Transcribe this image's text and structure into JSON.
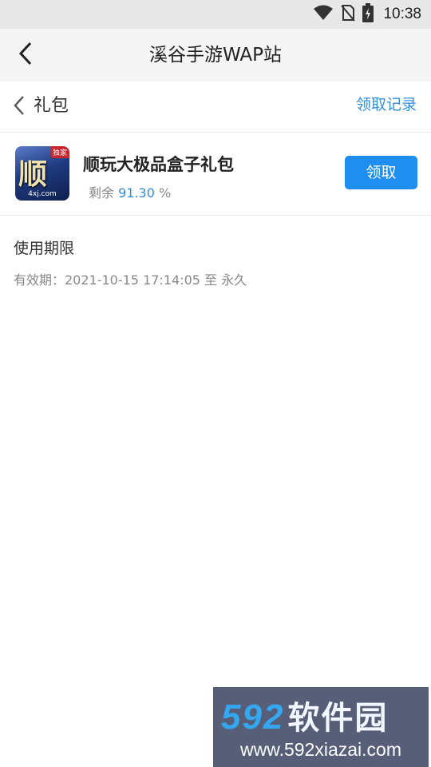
{
  "status_bar": {
    "time": "10:38",
    "icons": [
      "wifi-icon",
      "no-sim-icon",
      "battery-charging-icon"
    ]
  },
  "app_bar": {
    "title": "溪谷手游WAP站",
    "back_icon": "chevron-left-icon"
  },
  "sub_header": {
    "title": "礼包",
    "back_icon": "chevron-left-icon",
    "link": "领取记录"
  },
  "gift": {
    "name": "顺玩大极品盒子礼包",
    "remaining_label": "剩余",
    "remaining_value": "91.30",
    "remaining_unit": "%",
    "claim_label": "领取",
    "icon": {
      "badge": "独家",
      "glyph": "顺玩",
      "domain": "4xj.com"
    }
  },
  "validity": {
    "title": "使用期限",
    "text": "有效期：2021-10-15 17:14:05 至 永久"
  },
  "watermark": {
    "brand_digits": "592",
    "brand_cn": "软件园",
    "url": "www.592xiazai.com"
  },
  "colors": {
    "accent": "#1e8ff0",
    "link": "#2f8fdc",
    "app_bar_bg": "#f5f5f5",
    "status_bar_bg": "#e8e8e8"
  }
}
